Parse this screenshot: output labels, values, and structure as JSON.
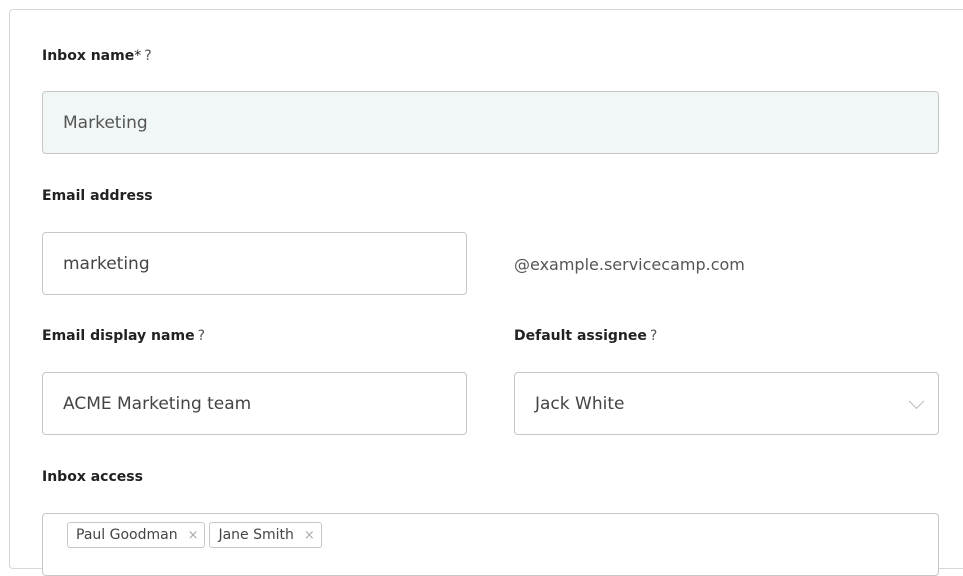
{
  "form": {
    "inbox_name": {
      "label": "Inbox name",
      "required_mark": "*",
      "help": "?",
      "value": "Marketing"
    },
    "email_address": {
      "label": "Email address",
      "value": "marketing",
      "domain_suffix": "@example.servicecamp.com"
    },
    "email_display_name": {
      "label": "Email display name",
      "help": "?",
      "value": "ACME Marketing team"
    },
    "default_assignee": {
      "label": "Default assignee",
      "help": "?",
      "selected": "Jack White",
      "icon": "chevron-down-icon"
    },
    "inbox_access": {
      "label": "Inbox access",
      "tags": [
        {
          "name": "Paul Goodman",
          "remove": "×"
        },
        {
          "name": "Jane Smith",
          "remove": "×"
        }
      ]
    }
  }
}
